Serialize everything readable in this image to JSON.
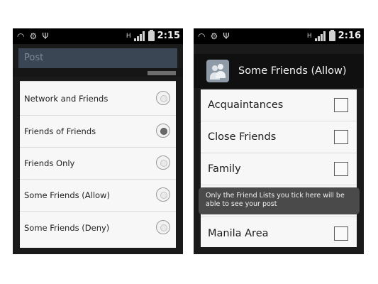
{
  "left_screen": {
    "status_bar": {
      "time": "2:15",
      "icons": [
        "wifi-icon",
        "android-debug-icon",
        "usb-icon",
        "data-h-icon",
        "signal-icon",
        "battery-icon"
      ]
    },
    "background_header": {
      "title": "Post"
    },
    "privacy_options": [
      {
        "label": "Network and Friends",
        "selected": false
      },
      {
        "label": "Friends of Friends",
        "selected": true
      },
      {
        "label": "Friends Only",
        "selected": false
      },
      {
        "label": "Some Friends (Allow)",
        "selected": false
      },
      {
        "label": "Some Friends (Deny)",
        "selected": false
      }
    ]
  },
  "right_screen": {
    "status_bar": {
      "time": "2:16",
      "icons": [
        "wifi-icon",
        "android-debug-icon",
        "usb-icon",
        "data-h-icon",
        "signal-icon",
        "battery-icon"
      ]
    },
    "dialog": {
      "title": "Some Friends (Allow)",
      "icon": "friends-icon",
      "friend_lists": [
        {
          "label": "Acquaintances",
          "checked": false
        },
        {
          "label": "Close Friends",
          "checked": false
        },
        {
          "label": "Family",
          "checked": false
        },
        {
          "label": "",
          "checked": false
        },
        {
          "label": "Manila Area",
          "checked": false
        }
      ],
      "tooltip": "Only the Friend Lists you tick here will be able to see your post"
    }
  }
}
